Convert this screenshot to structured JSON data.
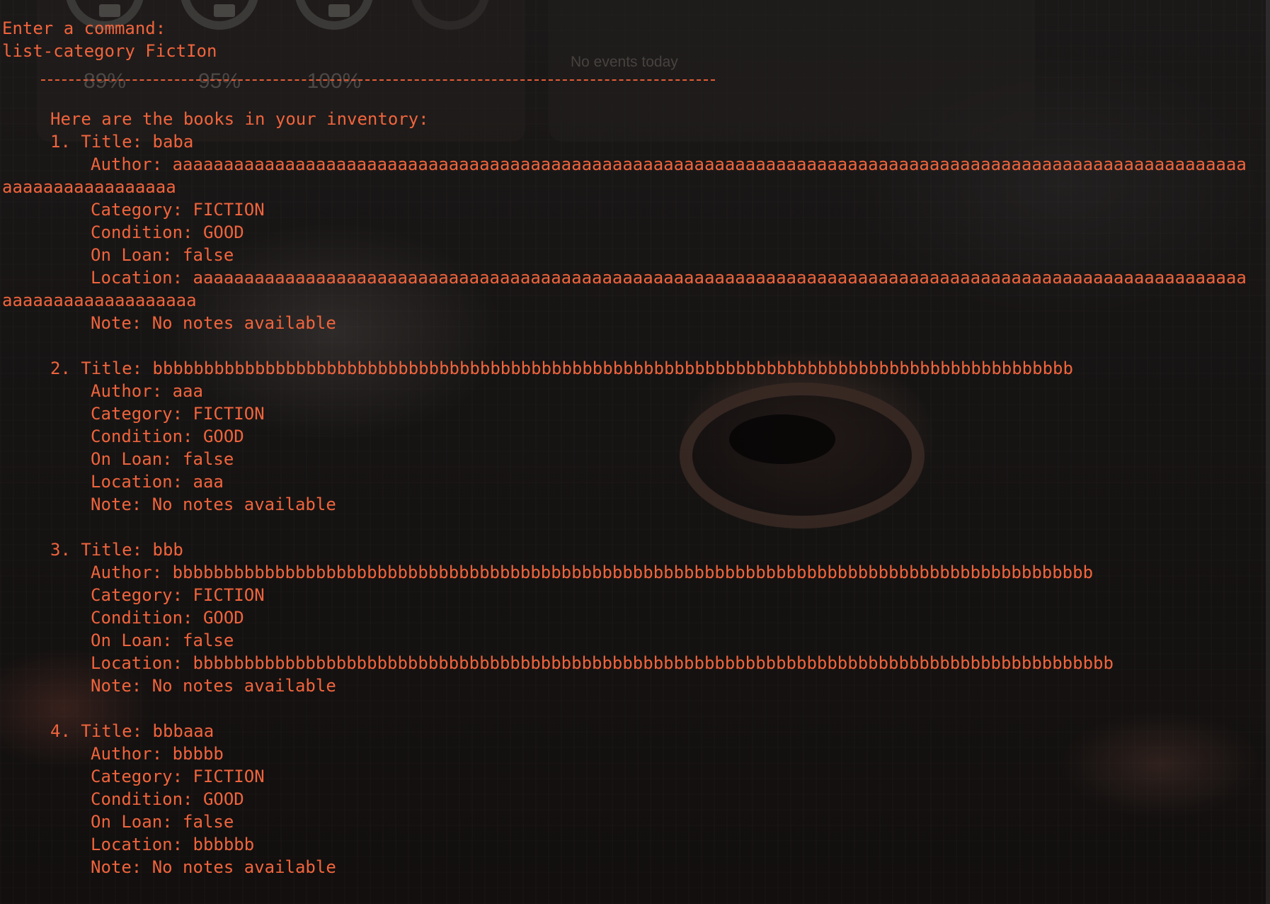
{
  "background": {
    "accent_color": "#f0643d",
    "widgets": {
      "battery_levels": [
        "89%",
        "95%",
        "100%"
      ],
      "events_text": "No events today"
    }
  },
  "terminal": {
    "prompt": "Enter a command:",
    "command": "list-category FictIon",
    "header": "Here are the books in your inventory:",
    "books": [
      {
        "title_line": "1. Title: baba",
        "author_line": "Author: aaaaaaaaaaaaaaaaaaaaaaaaaaaaaaaaaaaaaaaaaaaaaaaaaaaaaaaaaaaaaaaaaaaaaaaaaaaaaaaaaaaaaaaaaaaaaaaaaaaaaaaaa",
        "author_wrap": "aaaaaaaaaaaaaaaaa",
        "category_line": "Category: FICTION",
        "condition_line": "Condition: GOOD",
        "loan_line": "On Loan: false",
        "location_line": "Location: aaaaaaaaaaaaaaaaaaaaaaaaaaaaaaaaaaaaaaaaaaaaaaaaaaaaaaaaaaaaaaaaaaaaaaaaaaaaaaaaaaaaaaaaaaaaaaaaaaaaaaa",
        "location_wrap": "aaaaaaaaaaaaaaaaaaa",
        "note_line": "Note: No notes available"
      },
      {
        "title_line": "2. Title: bbbbbbbbbbbbbbbbbbbbbbbbbbbbbbbbbbbbbbbbbbbbbbbbbbbbbbbbbbbbbbbbbbbbbbbbbbbbbbbbbbbbbbbbbb",
        "author_line": "Author: aaa",
        "category_line": "Category: FICTION",
        "condition_line": "Condition: GOOD",
        "loan_line": "On Loan: false",
        "location_line": "Location: aaa",
        "note_line": "Note: No notes available"
      },
      {
        "title_line": "3. Title: bbb",
        "author_line": "Author: bbbbbbbbbbbbbbbbbbbbbbbbbbbbbbbbbbbbbbbbbbbbbbbbbbbbbbbbbbbbbbbbbbbbbbbbbbbbbbbbbbbbbbbbbb",
        "category_line": "Category: FICTION",
        "condition_line": "Condition: GOOD",
        "loan_line": "On Loan: false",
        "location_line": "Location: bbbbbbbbbbbbbbbbbbbbbbbbbbbbbbbbbbbbbbbbbbbbbbbbbbbbbbbbbbbbbbbbbbbbbbbbbbbbbbbbbbbbbbbbbb",
        "note_line": "Note: No notes available"
      },
      {
        "title_line": "4. Title: bbbaaa",
        "author_line": "Author: bbbbb",
        "category_line": "Category: FICTION",
        "condition_line": "Condition: GOOD",
        "loan_line": "On Loan: false",
        "location_line": "Location: bbbbbb",
        "note_line": "Note: No notes available"
      }
    ]
  }
}
